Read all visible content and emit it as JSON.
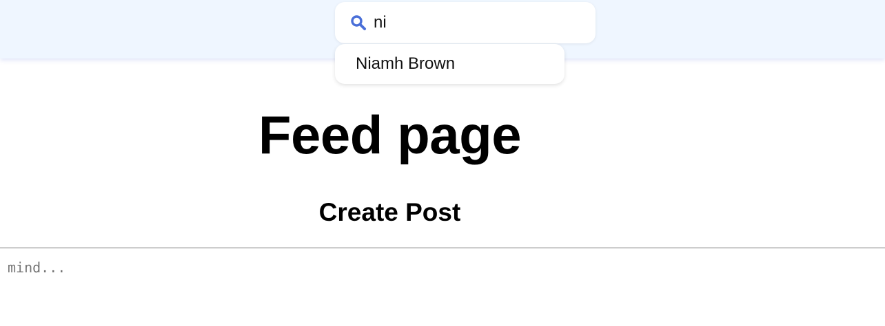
{
  "search": {
    "value": "ni",
    "suggestions": [
      {
        "label": "Niamh Brown"
      }
    ]
  },
  "page": {
    "title": "Feed page",
    "create_post_title": "Create Post"
  },
  "post": {
    "placeholder": "mind..."
  },
  "colors": {
    "topbar_bg": "#eff6ff",
    "search_icon": "#4a6fd8"
  },
  "icons": {
    "search": "search-icon"
  }
}
